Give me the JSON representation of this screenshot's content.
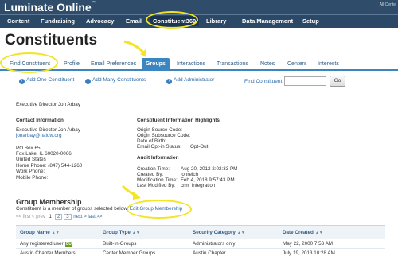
{
  "header": {
    "brand": "Luminate Online",
    "trademark": "™",
    "right_text": "All Cente"
  },
  "nav": {
    "items": [
      "Content",
      "Fundraising",
      "Advocacy",
      "Email",
      "Constituent360",
      "Library",
      "Data Management",
      "Setup"
    ],
    "active": "Constituent360"
  },
  "page": {
    "title": "Constituents"
  },
  "tabs": [
    "Find Constituent",
    "Profile",
    "Email Preferences",
    "Groups",
    "Interactions",
    "Transactions",
    "Notes",
    "Centers",
    "Interests"
  ],
  "active_tab": "Groups",
  "actions": {
    "add_one": "Add One Constituent",
    "add_many": "Add Many Constituents",
    "add_admin": "Add Administrator"
  },
  "find": {
    "label": "Find Constituent:",
    "value": "",
    "go": "Go"
  },
  "constituent": {
    "name_line": "Executive Director Jon Arbay",
    "contact_title": "Contact Information",
    "contact_name": "Executive Director Jon Arbay",
    "email": "jonarbay@naidw.org",
    "addr1": "PO Box 65",
    "addr2": "Fox Lake, IL  60020-0066",
    "country": "United States",
    "home_phone": "Home Phone:  (847) 544-1260",
    "work_phone": "Work Phone:",
    "mobile_phone": "Mobile Phone:"
  },
  "highlights": {
    "title": "Constituent Information Highlights",
    "origin_source": "Origin Source Code:",
    "origin_subsource": "Origin Subsource Code:",
    "dob": "Date of Birth:",
    "email_optin_label": "Email Opt-in Status:",
    "email_optin_value": "Opt-Out",
    "audit_title": "Audit Information",
    "creation_time_label": "Creation Time:",
    "creation_time_value": "Aug 20, 2012 2:02:33 PM",
    "created_by_label": "Created By:",
    "created_by_value": "jonreich",
    "mod_time_label": "Modification Time:",
    "mod_time_value": "Feb 4, 2018 9:57:43 PM",
    "mod_by_label": "Last Modified By:",
    "mod_by_value": "crm_integration"
  },
  "groups": {
    "title": "Group Membership",
    "desc": "Constituent is a member of groups selected below.",
    "edit_link": "Edit Group Membership",
    "pager": {
      "first": "<< first",
      "prev": "< prev",
      "pages": [
        "1",
        "2",
        "3"
      ],
      "next": "next >",
      "last": "last >>"
    },
    "columns": [
      "Group Name",
      "Group Type",
      "Security Category",
      "Date Created"
    ],
    "rows": [
      [
        "Any registered user",
        "Built-In-Groups",
        "Administrators only",
        "May 22, 2000 7:53 AM"
      ],
      [
        "Austin Chapter Members",
        "Center Member Groups",
        "Austin Chapter",
        "July 19, 2013 10:28 AM"
      ]
    ],
    "row_badge": "CU"
  },
  "colors": {
    "topbar": "#2f4d6b",
    "accent_tab": "#3b86c0",
    "highlight_annotation": "#f2e426",
    "link": "#2a6aa8"
  }
}
